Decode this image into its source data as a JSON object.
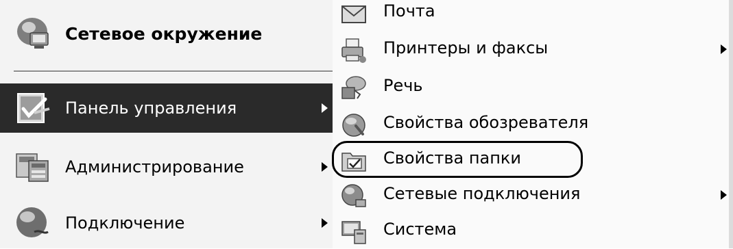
{
  "left_menu": {
    "items": [
      {
        "label": "Сетевое окружение",
        "icon": "network-places-icon"
      },
      {
        "label": "Панель управления",
        "icon": "control-panel-icon",
        "has_submenu": true,
        "selected": true
      },
      {
        "label": "Администрирование",
        "icon": "administrative-tools-icon",
        "has_submenu": true
      },
      {
        "label": "Подключение",
        "icon": "connect-to-icon",
        "has_submenu": true
      }
    ]
  },
  "submenu": {
    "items": [
      {
        "label": "Почта",
        "icon": "mail-icon"
      },
      {
        "label": "Принтеры и факсы",
        "icon": "printers-faxes-icon",
        "has_submenu": true
      },
      {
        "label": "Речь",
        "icon": "speech-icon"
      },
      {
        "label": "Свойства обозревателя",
        "icon": "internet-options-icon"
      },
      {
        "label": "Свойства папки",
        "icon": "folder-options-icon",
        "circled": true
      },
      {
        "label": "Сетевые подключения",
        "icon": "network-connections-icon",
        "has_submenu": true
      },
      {
        "label": "Система",
        "icon": "system-icon"
      }
    ]
  }
}
